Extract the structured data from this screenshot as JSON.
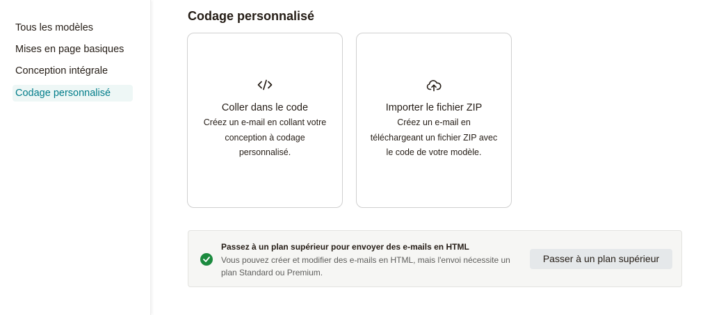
{
  "sidebar": {
    "items": [
      {
        "label": "Tous les modèles",
        "active": false
      },
      {
        "label": "Mises en page basiques",
        "active": false
      },
      {
        "label": "Conception intégrale",
        "active": false
      },
      {
        "label": "Codage personnalisé",
        "active": true
      }
    ]
  },
  "main": {
    "title": "Codage personnalisé",
    "cards": [
      {
        "icon": "code-icon",
        "title": "Coller dans le code",
        "description_lines": [
          "Créez un e-mail en collant votre",
          "conception à codage",
          "personnalisé."
        ]
      },
      {
        "icon": "cloud-upload-icon",
        "title": "Importer le fichier ZIP",
        "description_lines": [
          "Créez un e-mail en",
          "téléchargeant un fichier ZIP avec",
          "le code de votre modèle."
        ]
      }
    ],
    "banner": {
      "icon": "check-circle-icon",
      "title": "Passez à un plan supérieur pour envoyer des e-mails en HTML",
      "description": "Vous pouvez créer et modifier des e-mails en HTML, mais l'envoi nécessite un plan Standard ou Premium.",
      "button_label": "Passer à un plan supérieur"
    }
  },
  "colors": {
    "accent": "#007c89",
    "active_bg": "#eef7f6",
    "success": "#1b8a3e"
  }
}
